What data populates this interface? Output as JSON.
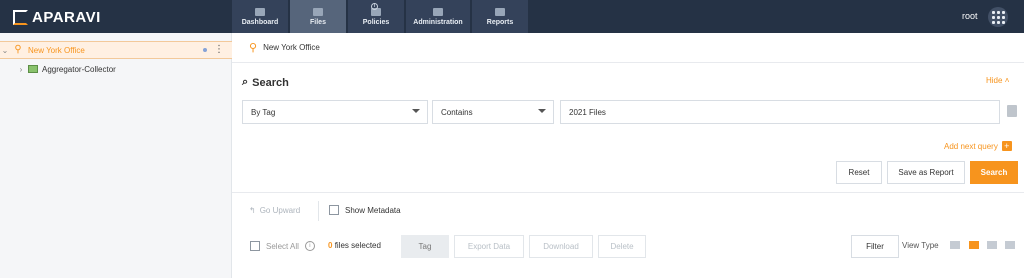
{
  "header": {
    "brand": "APARAVI",
    "tabs": [
      {
        "label": "Dashboard"
      },
      {
        "label": "Files"
      },
      {
        "label": "Policies"
      },
      {
        "label": "Administration"
      },
      {
        "label": "Reports"
      }
    ],
    "files_info": "i",
    "user": "root"
  },
  "sidebar": {
    "selected": {
      "label": "New York Office"
    },
    "child": {
      "label": "Aggregator-Collector"
    }
  },
  "main": {
    "breadcrumb": "New York Office",
    "search_title": "Search",
    "hide_label": "Hide",
    "query": {
      "field": "By Tag",
      "operator": "Contains",
      "value": "2021 Files"
    },
    "add_query": "Add next query",
    "buttons": {
      "reset": "Reset",
      "save_report": "Save as Report",
      "search": "Search"
    },
    "toolbar": {
      "go_upward": "Go Upward",
      "show_metadata": "Show Metadata"
    },
    "bottom": {
      "select_all": "Select All",
      "files_count": "0",
      "files_suffix": "files selected",
      "tag": "Tag",
      "export_data": "Export Data",
      "download": "Download",
      "delete": "Delete",
      "filter": "Filter",
      "view_type": "View Type"
    }
  }
}
